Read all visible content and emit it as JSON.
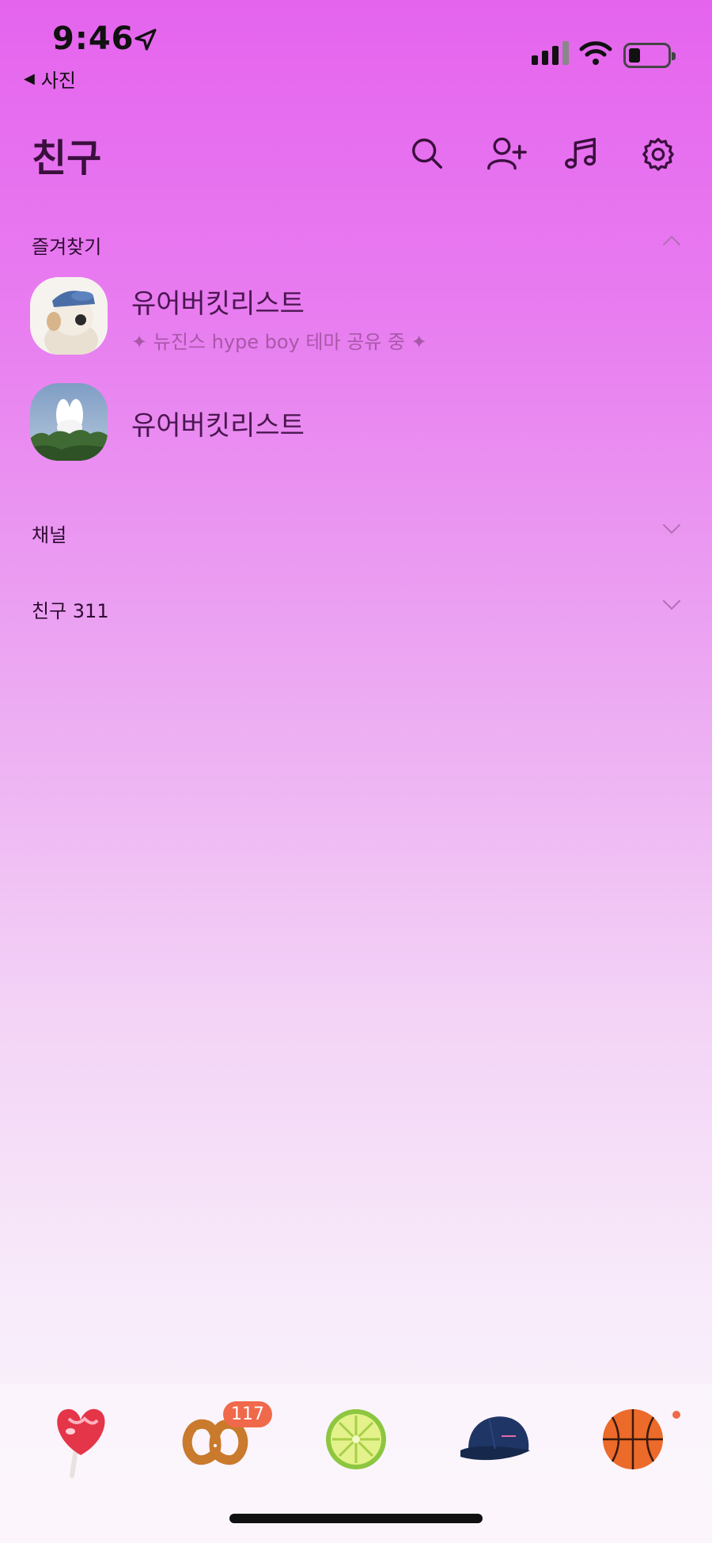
{
  "status_bar": {
    "time": "9:46",
    "back_label": "사진"
  },
  "header": {
    "title": "친구"
  },
  "sections": {
    "favorites": {
      "label": "즐겨찾기"
    },
    "channel": {
      "label": "채널"
    },
    "friends": {
      "label": "친구 311"
    }
  },
  "favorites": [
    {
      "name": "유어버킷리스트",
      "status": "✦ 뉴진스 hype boy 테마 공유 중 ✦"
    },
    {
      "name": "유어버킷리스트"
    }
  ],
  "tabbar": {
    "badge": "117"
  },
  "icons": [
    "location-arrow-icon",
    "signal-icon",
    "wifi-icon",
    "battery-icon",
    "search-icon",
    "add-friend-icon",
    "music-icon",
    "gear-icon",
    "chevron-up-icon",
    "chevron-down-icon",
    "lollipop-icon",
    "pretzel-icon",
    "lime-icon",
    "cap-icon",
    "basketball-icon"
  ],
  "colors": {
    "accent": "#e564ee",
    "badge": "#f0694a",
    "text": "#3a0f3d"
  }
}
